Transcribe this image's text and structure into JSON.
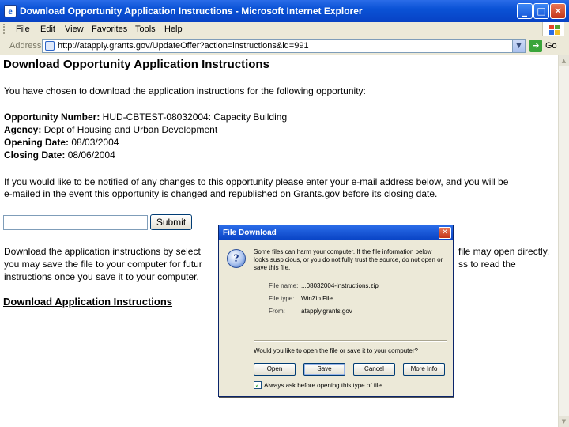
{
  "window": {
    "title": "Download Opportunity Application Instructions - Microsoft Internet Explorer",
    "minimize": "_",
    "maximize": "□",
    "close": "✕",
    "menu": [
      "File",
      "Edit",
      "View",
      "Favorites",
      "Tools",
      "Help"
    ]
  },
  "address_bar": {
    "label": "Address",
    "url": "http://atapply.grants.gov/UpdateOffer?action=instructions&id=991",
    "go": "Go"
  },
  "page": {
    "heading": "Download Opportunity Application Instructions",
    "intro": "You have chosen to download the application instructions for the following opportunity:",
    "fields": [
      {
        "label": "Opportunity Number:",
        "value": "HUD-CBTEST-08032004: Capacity Building"
      },
      {
        "label": "Agency:",
        "value": "Dept of Housing and Urban Development"
      },
      {
        "label": "Opening Date:",
        "value": "08/03/2004"
      },
      {
        "label": "Closing Date:",
        "value": "08/06/2004"
      }
    ],
    "notify_line1": "If you would like to be notified of any changes to this opportunity please enter your e-mail address below, and you will be",
    "notify_line2": "e-mailed in the event this opportunity is changed and republished on Grants.gov before its closing date.",
    "email_value": "",
    "submit_label": "Submit",
    "download_line1_left": "Download the application instructions by select",
    "download_line1_right": "file may open directly,",
    "download_line2_left": "you may save the file to your computer for futur",
    "download_line2_right": "ss to read the",
    "download_line3": "instructions once you save it to your computer.",
    "download_link": "Download Application Instructions"
  },
  "dialog": {
    "title": "File Download",
    "close": "✕",
    "warning_line1": "Some files can harm your computer. If the file information below",
    "warning_line2": "looks suspicious, or you do not fully trust the source, do not open or",
    "warning_line3": "save this file.",
    "file_name_label": "File name:",
    "file_name": "...08032004-instructions.zip",
    "file_type_label": "File type:",
    "file_type": "WinZip File",
    "from_label": "From:",
    "from": "atapply.grants.gov",
    "question": "Would you like to open the file or save it to your computer?",
    "buttons": [
      "Open",
      "Save",
      "Cancel",
      "More Info"
    ],
    "checkbox_checked": true,
    "checkbox_label": "Always ask before opening this type of file"
  }
}
